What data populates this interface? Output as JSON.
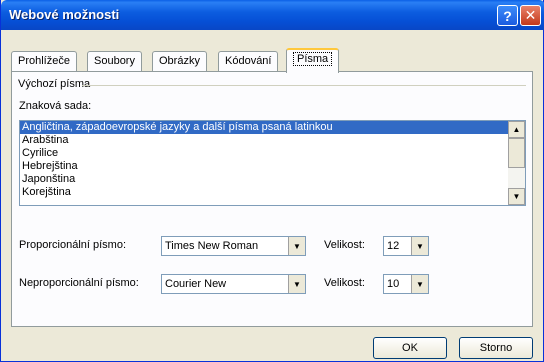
{
  "window": {
    "title": "Webové možnosti"
  },
  "titlebar": {
    "help_label": "?",
    "close_label": "✕"
  },
  "tabs": [
    {
      "label": "Prohlížeče"
    },
    {
      "label": "Soubory"
    },
    {
      "label": "Obrázky"
    },
    {
      "label": "Kódování"
    },
    {
      "label": "Písma",
      "active": true
    }
  ],
  "fonts_panel": {
    "group_title": "Výchozí písma",
    "charset_label": "Znaková sada:",
    "charset_list": [
      "Angličtina, západoevropské jazyky a další písma psaná latinkou",
      "Arabština",
      "Cyrilice",
      "Hebrejština",
      "Japonština",
      "Korejština"
    ],
    "selected_index": 0,
    "proportional_label": "Proporcionální písmo:",
    "proportional_value": "Times New Roman",
    "proportional_size_label": "Velikost:",
    "proportional_size_value": "12",
    "nonproportional_label": "Neproporcionální písmo:",
    "nonproportional_value": "Courier New",
    "nonproportional_size_label": "Velikost:",
    "nonproportional_size_value": "10"
  },
  "buttons": {
    "ok": "OK",
    "cancel": "Storno"
  },
  "colors": {
    "titlebar": "#0a5fe6",
    "selection": "#316ac5",
    "dialog_bg": "#ece9d8",
    "active_tab_accent": "#ffc83c"
  }
}
